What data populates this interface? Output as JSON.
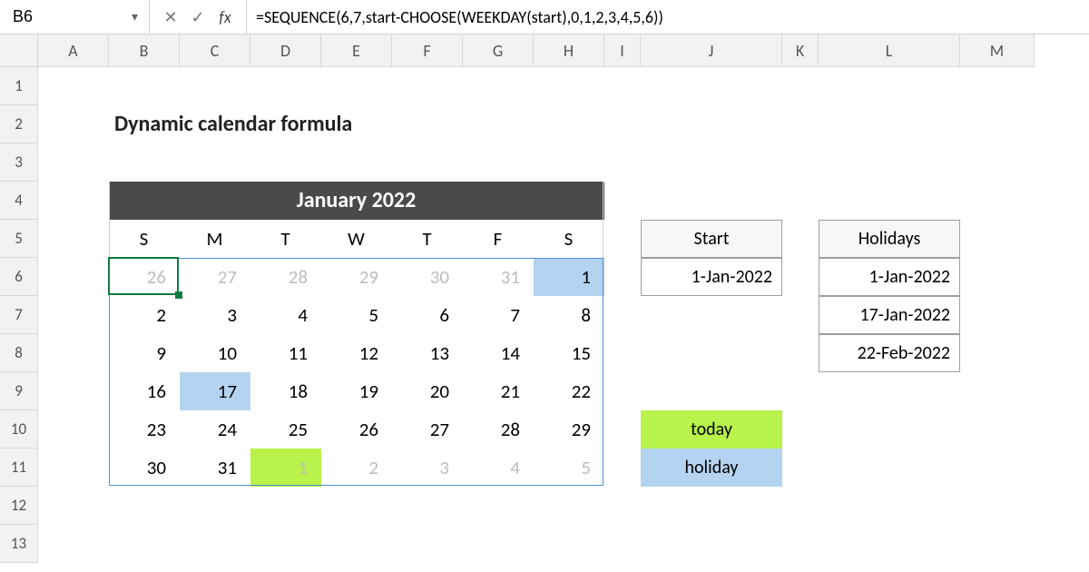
{
  "formula_bar": {
    "cell_ref": "B6",
    "cancel": "✕",
    "confirm": "✓",
    "fx": "fx",
    "formula": "=SEQUENCE(6,7,start-CHOOSE(WEEKDAY(start),0,1,2,3,4,5,6))"
  },
  "columns": [
    "A",
    "B",
    "C",
    "D",
    "E",
    "F",
    "G",
    "H",
    "I",
    "J",
    "K",
    "L",
    "M"
  ],
  "rows": [
    "1",
    "2",
    "3",
    "4",
    "5",
    "6",
    "7",
    "8",
    "9",
    "10",
    "11",
    "12",
    "13"
  ],
  "title": "Dynamic calendar formula",
  "calendar": {
    "banner": "January 2022",
    "weekday_headers": [
      "S",
      "M",
      "T",
      "W",
      "T",
      "F",
      "S"
    ],
    "grid": [
      [
        {
          "v": "26",
          "dim": true
        },
        {
          "v": "27",
          "dim": true
        },
        {
          "v": "28",
          "dim": true
        },
        {
          "v": "29",
          "dim": true
        },
        {
          "v": "30",
          "dim": true
        },
        {
          "v": "31",
          "dim": true
        },
        {
          "v": "1",
          "holiday": true
        }
      ],
      [
        {
          "v": "2"
        },
        {
          "v": "3"
        },
        {
          "v": "4"
        },
        {
          "v": "5"
        },
        {
          "v": "6"
        },
        {
          "v": "7"
        },
        {
          "v": "8"
        }
      ],
      [
        {
          "v": "9"
        },
        {
          "v": "10"
        },
        {
          "v": "11"
        },
        {
          "v": "12"
        },
        {
          "v": "13"
        },
        {
          "v": "14"
        },
        {
          "v": "15"
        }
      ],
      [
        {
          "v": "16"
        },
        {
          "v": "17",
          "holiday": true
        },
        {
          "v": "18"
        },
        {
          "v": "19"
        },
        {
          "v": "20"
        },
        {
          "v": "21"
        },
        {
          "v": "22"
        }
      ],
      [
        {
          "v": "23"
        },
        {
          "v": "24"
        },
        {
          "v": "25"
        },
        {
          "v": "26"
        },
        {
          "v": "27"
        },
        {
          "v": "28"
        },
        {
          "v": "29"
        }
      ],
      [
        {
          "v": "30"
        },
        {
          "v": "31"
        },
        {
          "v": "1",
          "dim": true,
          "today": true
        },
        {
          "v": "2",
          "dim": true
        },
        {
          "v": "3",
          "dim": true
        },
        {
          "v": "4",
          "dim": true
        },
        {
          "v": "5",
          "dim": true
        }
      ]
    ]
  },
  "side": {
    "start_label": "Start",
    "start_value": "1-Jan-2022",
    "holidays_label": "Holidays",
    "holidays": [
      "1-Jan-2022",
      "17-Jan-2022",
      "22-Feb-2022"
    ],
    "legend_today": "today",
    "legend_holiday": "holiday"
  },
  "colors": {
    "today": "#b8f24a",
    "holiday": "#b4d3f0",
    "selection": "#107c41",
    "spill": "#4f90d6"
  }
}
